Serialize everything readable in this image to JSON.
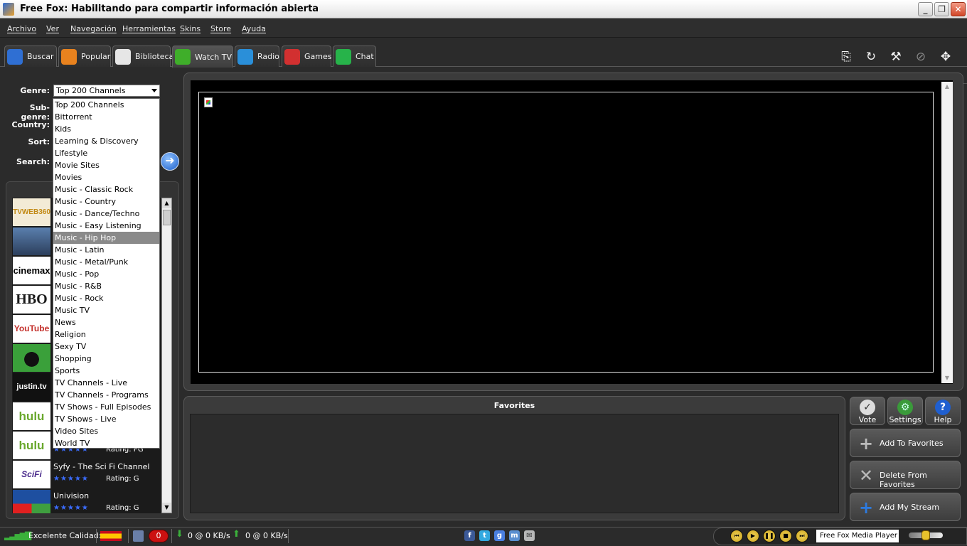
{
  "window": {
    "title": "Free Fox: Habilitando para compartir información abierta",
    "minimize": "_",
    "maximize": "❐",
    "close": "✕"
  },
  "menu": [
    "Archivo",
    "Ver",
    "Navegación",
    "Herramientas",
    "Skins",
    "Store",
    "Ayuda"
  ],
  "tabs": [
    {
      "label": "Buscar",
      "icon": "search-icon",
      "color": "#2f6fd3"
    },
    {
      "label": "Popular",
      "icon": "music-note-icon",
      "color": "#e8821e"
    },
    {
      "label": "Biblioteca",
      "icon": "folder-icon",
      "color": "#e6e6e6"
    },
    {
      "label": "Watch TV",
      "icon": "play-icon",
      "color": "#3fae2a"
    },
    {
      "label": "Radio",
      "icon": "wifi-icon",
      "color": "#2a8fd9"
    },
    {
      "label": "Games",
      "icon": "dice-icon",
      "color": "#d23030"
    },
    {
      "label": "Chat",
      "icon": "chat-bubble-icon",
      "color": "#27b34a"
    }
  ],
  "active_tab": "Watch TV",
  "toolbar_icons": [
    "print-icon",
    "refresh-icon",
    "wrench-icon",
    "block-icon",
    "fullscreen-icon"
  ],
  "filters": {
    "genre_label": "Genre:",
    "subgenre_label": "Sub-genre:",
    "country_label": "Country:",
    "sort_label": "Sort:",
    "search_label": "Search:",
    "genre_value": "Top 200 Channels"
  },
  "genre_options": [
    "Top 200 Channels",
    "Bittorrent",
    "Kids",
    "Learning & Discovery",
    "Lifestyle",
    "Movie Sites",
    "Movies",
    "Music - Classic Rock",
    "Music - Country",
    "Music - Dance/Techno",
    "Music - Easy Listening",
    "Music - Hip Hop",
    "Music - Latin",
    "Music - Metal/Punk",
    "Music - Pop",
    "Music - R&B",
    "Music - Rock",
    "Music TV",
    "News",
    "Religion",
    "Sexy TV",
    "Shopping",
    "Sports",
    "TV Channels - Live",
    "TV Channels - Programs",
    "TV Shows - Full Episodes",
    "TV Shows - Live",
    "Video Sites",
    "World TV"
  ],
  "highlighted_option": "Music - Hip Hop",
  "channels": [
    {
      "thumb": "TVWEB360",
      "name": "",
      "rating": ""
    },
    {
      "thumb": "",
      "name": "",
      "rating": ""
    },
    {
      "thumb": "cinemax",
      "name": "",
      "rating": ""
    },
    {
      "thumb": "HBO",
      "name": "",
      "rating": ""
    },
    {
      "thumb": "YouTube",
      "name": "",
      "rating": ""
    },
    {
      "thumb": "",
      "name": "",
      "rating": ""
    },
    {
      "thumb": "justin.tv",
      "name": "",
      "rating": ""
    },
    {
      "thumb": "hulu",
      "name": "",
      "rating": ""
    },
    {
      "thumb": "hulu",
      "name": "",
      "rating": "Rating: PG"
    },
    {
      "thumb": "SciFi",
      "name": "Syfy - The Sci Fi Channel",
      "rating": "Rating: G"
    },
    {
      "thumb": "",
      "name": "Univision",
      "rating": "Rating: G"
    }
  ],
  "stars": "★★★★★",
  "favorites": {
    "title": "Favorites"
  },
  "side_buttons": {
    "vote": "Vote",
    "settings": "Settings",
    "help": "Help",
    "help_icon": "?"
  },
  "actions": {
    "add_favorites": "Add To Favorites",
    "delete_favorites": "Delete From Favorites",
    "add_stream": "Add My Stream"
  },
  "status": {
    "quality": "Excelente Calidad:",
    "count": "0",
    "download": "0 @ 0 KB/s",
    "upload": "0 @ 0 KB/s",
    "player": "Free Fox Media Player"
  },
  "social_icons": [
    "facebook-icon",
    "twitter-icon",
    "google-icon",
    "messenger-icon",
    "mail-icon"
  ],
  "colors": {
    "accent": "#2f6fd3",
    "highlight": "#8a8a8a",
    "status_red": "#cc1111"
  }
}
